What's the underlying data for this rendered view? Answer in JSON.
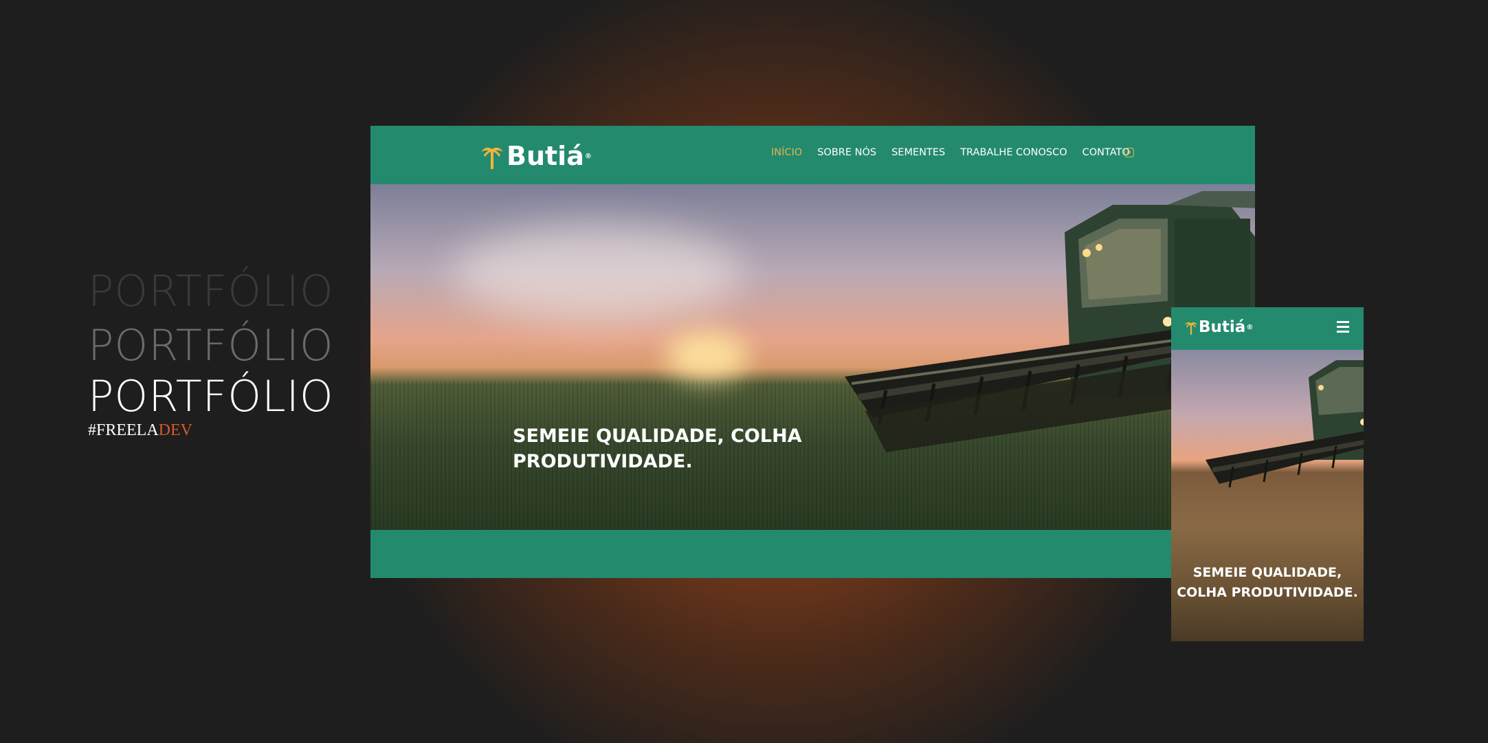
{
  "portfolio": {
    "heading_faded": "PORTFÓLIO",
    "heading_mid": "PORTFÓLIO",
    "heading_main": "PORTFÓLIO",
    "tag_prefix": "#FREELA",
    "tag_suffix": "DEV"
  },
  "desktop": {
    "logo_text": "Butiá",
    "logo_registered": "®",
    "nav": [
      "INÍCIO",
      "SOBRE NÓS",
      "SEMENTES",
      "TRABALHE CONOSCO",
      "CONTATO"
    ],
    "active_nav": "INÍCIO",
    "social_icon": "instagram-icon",
    "hero_headline": "SEMEIE QUALIDADE, COLHA PRODUTIVIDADE."
  },
  "mobile": {
    "logo_text": "Butiá",
    "logo_registered": "®",
    "menu_icon": "hamburger-menu-icon",
    "hero_headline": "SEMEIE QUALIDADE, COLHA PRODUTIVIDADE."
  },
  "colors": {
    "brand_green": "#248a6e",
    "brand_gold": "#f0b43a",
    "accent_orange": "#d65a2a",
    "background_dark": "#1e1e1e"
  }
}
